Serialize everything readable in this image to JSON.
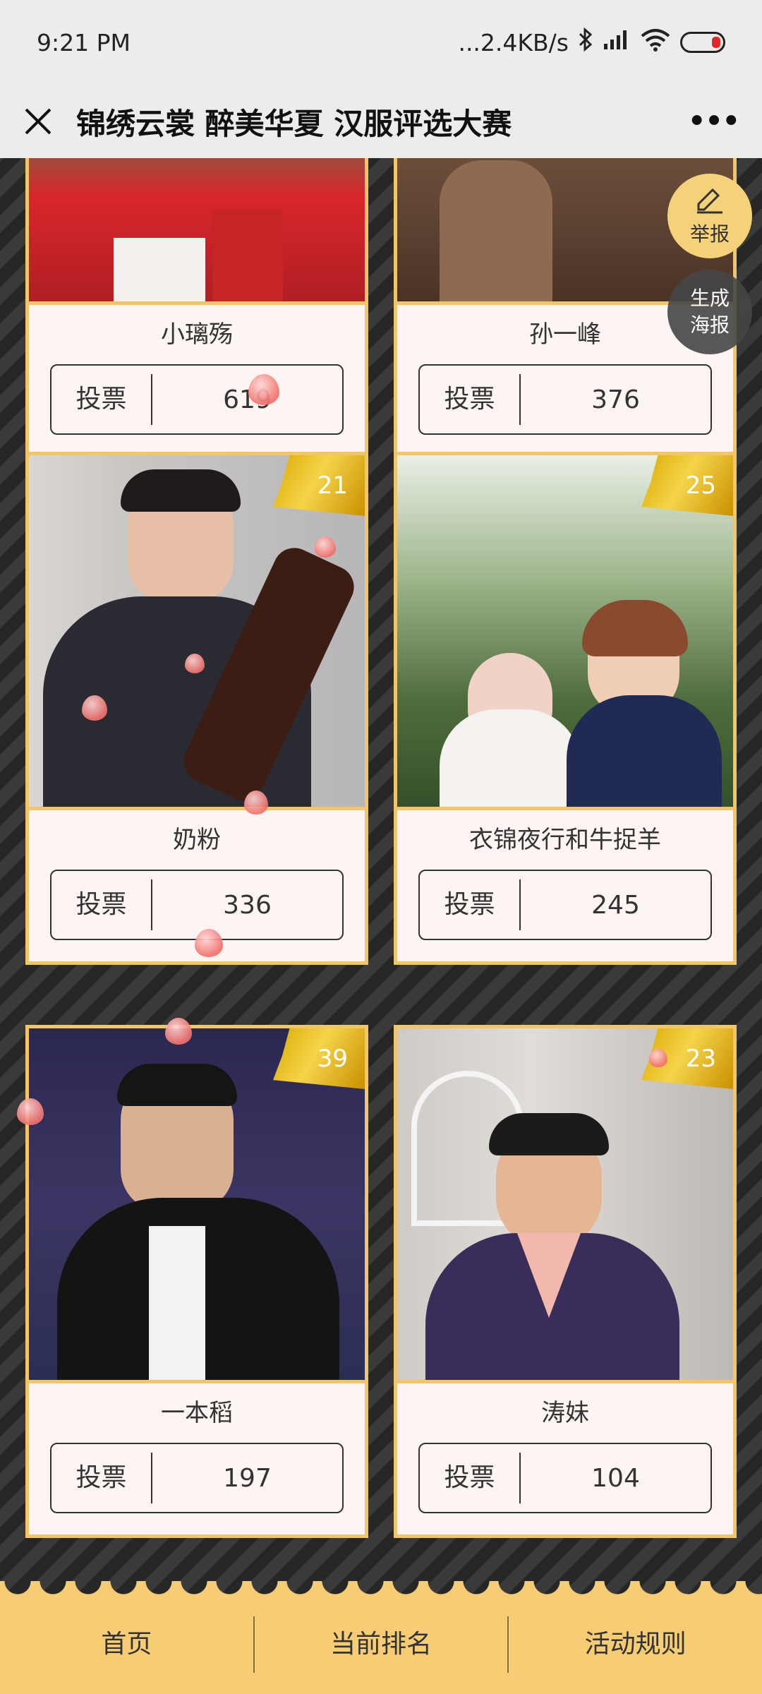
{
  "status": {
    "time": "9:21 PM",
    "network_speed": "...2.4KB/s",
    "icons": [
      "bluetooth-icon",
      "signal-icon",
      "wifi-icon",
      "battery-icon"
    ]
  },
  "header": {
    "title": "锦绣云裳 醉美华夏 汉服评选大赛"
  },
  "side_actions": {
    "report_label": "举报",
    "poster_label_line1": "生成",
    "poster_label_line2": "海报"
  },
  "vote_label": "投票",
  "contestants": [
    {
      "name": "小璃殇",
      "votes": "619",
      "rank": ""
    },
    {
      "name": "孙一峰",
      "votes": "376",
      "rank": ""
    },
    {
      "name": "奶粉",
      "votes": "336",
      "rank": "21"
    },
    {
      "name": "衣锦夜行和牛捉羊",
      "votes": "245",
      "rank": "25"
    },
    {
      "name": "一本稻",
      "votes": "197",
      "rank": "39"
    },
    {
      "name": "涛妹",
      "votes": "104",
      "rank": "23"
    }
  ],
  "bottom_nav": {
    "home": "首页",
    "ranking": "当前排名",
    "rules": "活动规则"
  },
  "colors": {
    "card_border": "#f1c56c",
    "card_bg": "#fdf5f3",
    "nav_bg": "#f7cc74",
    "report_bg": "#f5d27a"
  }
}
